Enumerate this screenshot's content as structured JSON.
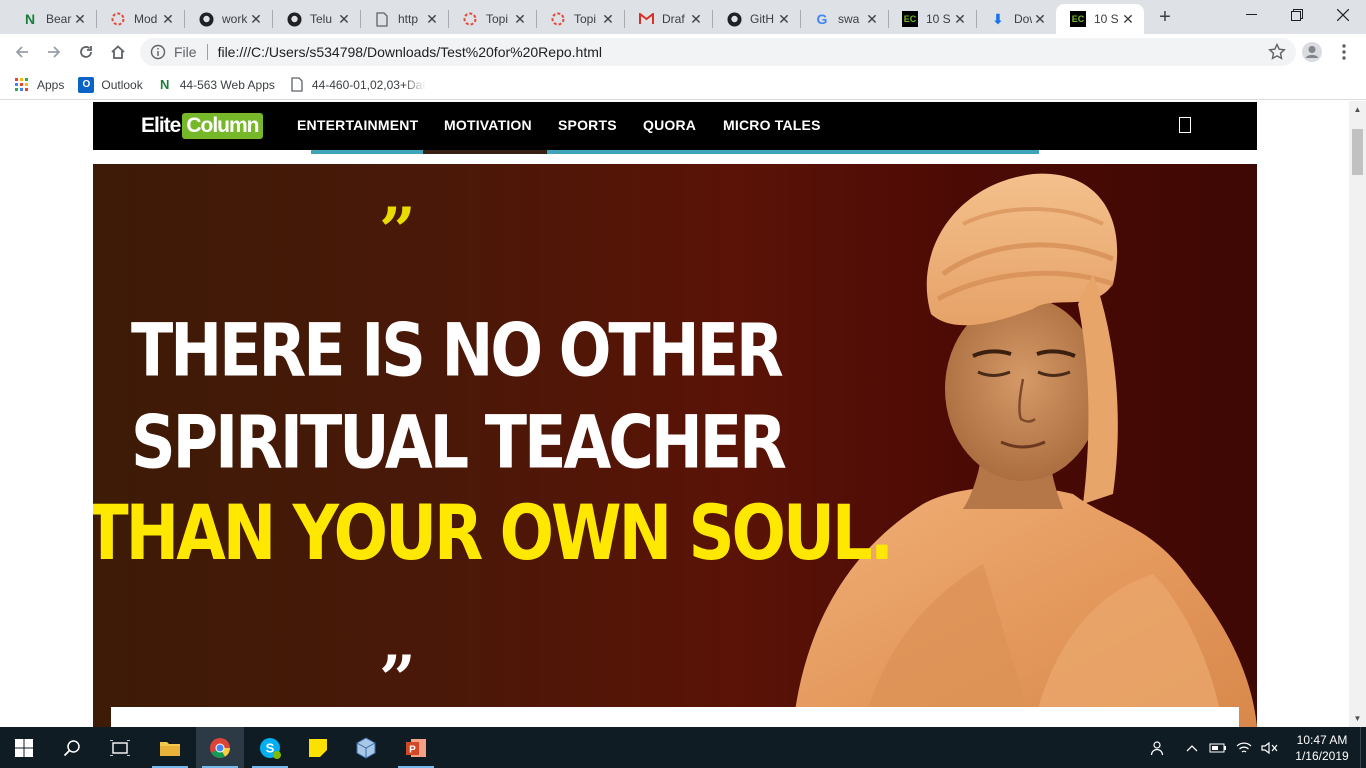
{
  "browser": {
    "tabs": [
      {
        "title": "Bear",
        "icon": "n-green-icon"
      },
      {
        "title": "Mod",
        "icon": "circle-red-icon"
      },
      {
        "title": "work",
        "icon": "github-icon"
      },
      {
        "title": "Telu",
        "icon": "github-icon"
      },
      {
        "title": "http",
        "icon": "page-icon"
      },
      {
        "title": "Topi",
        "icon": "circle-red-icon"
      },
      {
        "title": "Topi",
        "icon": "circle-red-icon"
      },
      {
        "title": "Draf",
        "icon": "gmail-icon"
      },
      {
        "title": "GitH",
        "icon": "github-icon"
      },
      {
        "title": "swa",
        "icon": "google-icon"
      },
      {
        "title": "10 S",
        "icon": "ec-icon"
      },
      {
        "title": "Dow",
        "icon": "download-icon"
      },
      {
        "title": "10 S",
        "icon": "ec-icon",
        "active": true
      }
    ],
    "new_tab_label": "+",
    "address": {
      "scheme_label": "File",
      "url": "file:///C:/Users/s534798/Downloads/Test%20for%20Repo.html"
    },
    "bookmarks": [
      {
        "label": "Apps",
        "icon": "apps-grid-icon"
      },
      {
        "label": "Outlook",
        "icon": "outlook-icon"
      },
      {
        "label": "44-563 Web Apps",
        "icon": "n-green-icon"
      },
      {
        "label": "44-460-01,02,03+Dat",
        "icon": "page-icon"
      }
    ]
  },
  "site": {
    "logo": {
      "part1": "Elite",
      "part2": "Column"
    },
    "nav": [
      "ENTERTAINMENT",
      "MOTIVATION",
      "SPORTS",
      "QUORA",
      "MICRO TALES"
    ],
    "hero": {
      "quote_open": "”",
      "line1": "THERE IS NO OTHER",
      "line2": "SPIRITUAL TEACHER",
      "line3": "THAN YOUR OWN SOUL.",
      "quote_close": "”"
    }
  },
  "taskbar": {
    "apps": [
      "start",
      "search",
      "task-view",
      "file-explorer",
      "chrome",
      "skype",
      "sticky-notes",
      "virtualbox",
      "powerpoint"
    ],
    "clock_time": "10:47 AM",
    "clock_date": "1/16/2019"
  },
  "colors": {
    "nav_bg": "#000000",
    "logo_accent": "#77b82a",
    "quote_yellow": "#ffe800",
    "hero_dark": "#4a1808"
  }
}
